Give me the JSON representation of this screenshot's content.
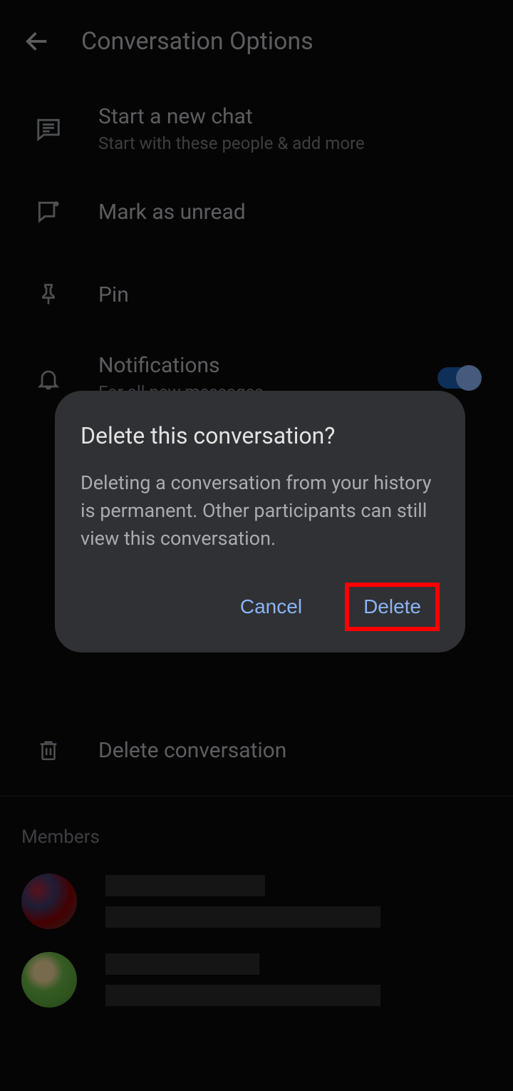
{
  "header": {
    "title": "Conversation Options"
  },
  "options": {
    "new_chat": {
      "title": "Start a new chat",
      "sub": "Start with these people & add more"
    },
    "mark_unread": {
      "title": "Mark as unread"
    },
    "pin": {
      "title": "Pin"
    },
    "notifications": {
      "title": "Notifications",
      "sub": "For all new messages"
    },
    "delete": {
      "title": "Delete conversation"
    }
  },
  "members": {
    "section_title": "Members"
  },
  "dialog": {
    "title": "Delete this conversation?",
    "body": "Deleting a conversation from your history is permanent. Other participants can still view this conversation.",
    "cancel": "Cancel",
    "delete": "Delete"
  }
}
